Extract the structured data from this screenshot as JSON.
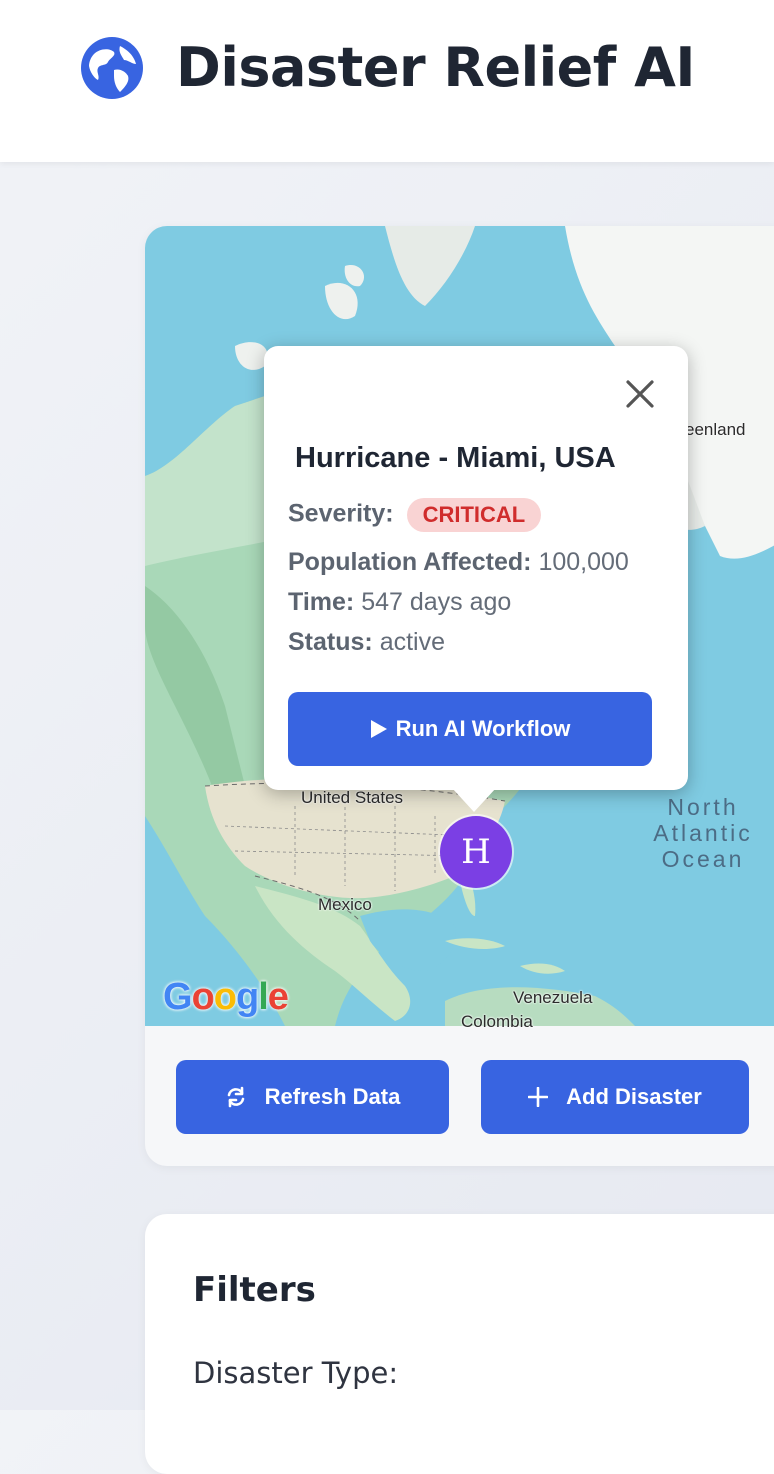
{
  "header": {
    "title": "Disaster Relief AI",
    "logo_icon": "globe-icon",
    "accent": "#3864e1"
  },
  "map": {
    "labels": {
      "united_states": "United States",
      "mexico": "Mexico",
      "venezuela": "Venezuela",
      "colombia": "Colombia",
      "greenland": "eenland"
    },
    "ocean_lines": [
      "North",
      "Atlantic",
      "Ocean"
    ],
    "attribution": "Google",
    "marker": {
      "letter": "H",
      "color": "#7b3fe4"
    }
  },
  "popup": {
    "title": "Hurricane - Miami, USA",
    "severity_label": "Severity:",
    "severity_value": "CRITICAL",
    "population_label": "Population Affected:",
    "population_value": "100,000",
    "time_label": "Time:",
    "time_value": "547 days ago",
    "status_label": "Status:",
    "status_value": "active",
    "run_button": "Run AI Workflow",
    "close_icon": "close-icon"
  },
  "actions": {
    "refresh_label": "Refresh Data",
    "add_label": "Add Disaster"
  },
  "filters": {
    "title": "Filters",
    "disaster_type_label": "Disaster Type:"
  }
}
